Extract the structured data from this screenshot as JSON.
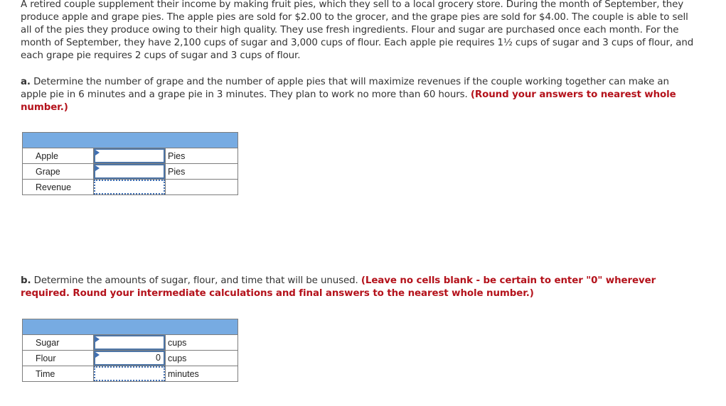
{
  "problem": {
    "intro": "A retired couple supplement their income by making fruit pies, which they sell to a local grocery store. During the month of September, they produce apple and grape pies. The apple pies are sold for $2.00 to the grocer, and the grape pies are sold for $4.00. The couple is able to sell all of the pies they produce owing to their high quality. They use fresh ingredients. Flour and sugar are purchased once each month. For the month of September, they have 2,100 cups of sugar and 3,000 cups of flour. Each apple pie requires 1½ cups of sugar and 3 cups of flour, and each grape pie requires 2 cups of sugar and 3 cups of flour."
  },
  "part_a": {
    "label": "a.",
    "text": " Determine the number of grape and the number of apple pies that will maximize revenues if the couple working together can make an apple pie in 6 minutes and a grape pie in 3 minutes. They plan to work no more than 60 hours. ",
    "instruction": "(Round your answers to nearest whole number.)",
    "table": {
      "rows": [
        {
          "label": "Apple",
          "value": "",
          "unit": "Pies",
          "kind": "input"
        },
        {
          "label": "Grape",
          "value": "",
          "unit": "Pies",
          "kind": "input"
        },
        {
          "label": "Revenue",
          "value": "",
          "unit": "",
          "kind": "calculated"
        }
      ]
    }
  },
  "part_b": {
    "label": "b.",
    "text": " Determine the amounts of sugar, flour, and time that will be unused. ",
    "instruction": "(Leave no cells blank - be certain to enter \"0\" wherever required. Round your intermediate calculations and final answers to the nearest whole number.)",
    "table": {
      "rows": [
        {
          "label": "Sugar",
          "value": "",
          "unit": "cups",
          "kind": "input"
        },
        {
          "label": "Flour",
          "value": "0",
          "unit": "cups",
          "kind": "input"
        },
        {
          "label": "Time",
          "value": "",
          "unit": "minutes",
          "kind": "calculated"
        }
      ]
    }
  },
  "colors": {
    "header_fill": "#77abe2",
    "instruction_red": "#b4121b",
    "input_border": "#4d75a6"
  }
}
